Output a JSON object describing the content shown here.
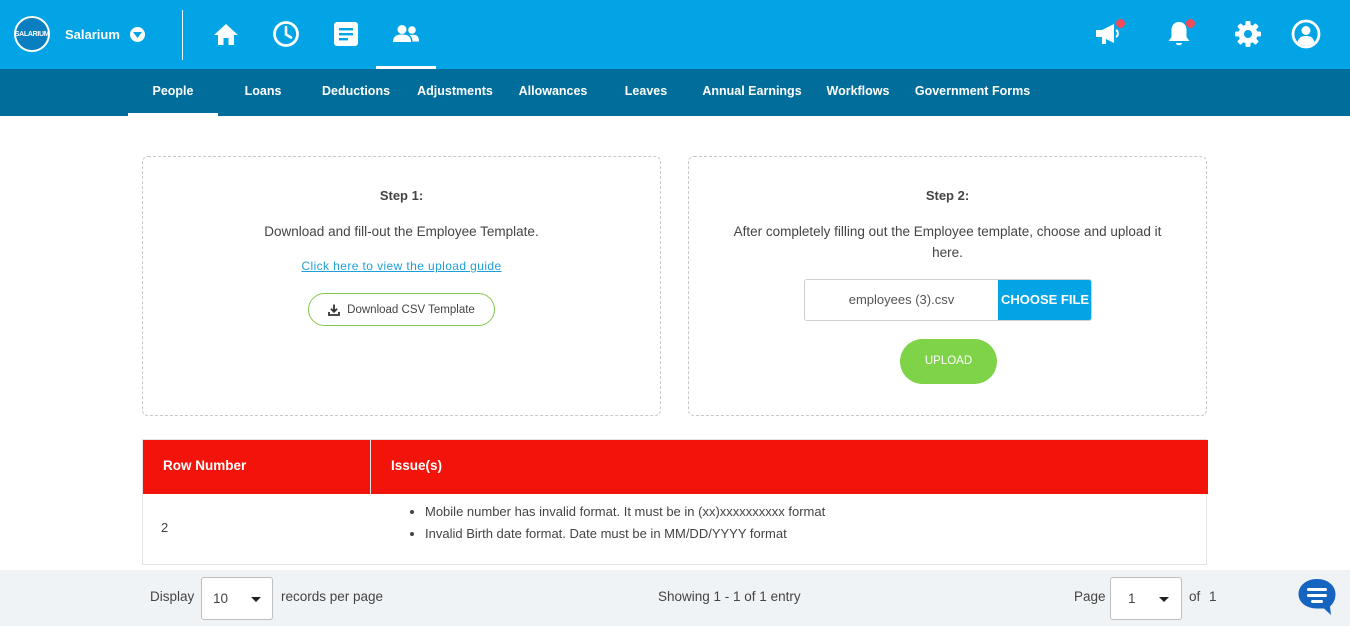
{
  "colors": {
    "topbar": "#02a4e5",
    "subnav": "#016d9b",
    "table_header": "#f2140a",
    "upload": "#7ed348",
    "choose": "#02a4e5",
    "link": "#1f9fd8"
  },
  "header": {
    "logo_text": "SALARIUM",
    "company_name": "Salarium",
    "nav_icons": [
      "home-icon",
      "clock-icon",
      "document-icon",
      "people-icon"
    ],
    "right_icons": [
      "megaphone-icon",
      "bell-icon",
      "gear-icon",
      "user-icon"
    ]
  },
  "subnav": {
    "items": [
      {
        "label": "People"
      },
      {
        "label": "Loans"
      },
      {
        "label": "Deductions"
      },
      {
        "label": "Adjustments"
      },
      {
        "label": "Allowances"
      },
      {
        "label": "Leaves"
      },
      {
        "label": "Annual Earnings"
      },
      {
        "label": "Workflows"
      },
      {
        "label": "Government Forms"
      }
    ]
  },
  "step1": {
    "title": "Step 1:",
    "text": "Download and fill-out the Employee Template.",
    "guide_link": "Click here to view the upload guide",
    "download_label": "Download CSV Template"
  },
  "step2": {
    "title": "Step 2:",
    "text": "After completely filling out the Employee template, choose and upload it here.",
    "file_name": "employees (3).csv",
    "choose_label": "CHOOSE FILE",
    "upload_label": "UPLOAD"
  },
  "issues_table": {
    "columns": [
      "Row Number",
      "Issue(s)"
    ],
    "rows": [
      {
        "row_number": "2",
        "issues": [
          "Mobile number has invalid format. It must be in (xx)xxxxxxxxxx format",
          "Invalid Birth date format. Date must be in MM/DD/YYYY format"
        ]
      }
    ]
  },
  "footer": {
    "display_label": "Display",
    "per_page_value": "10",
    "records_label": "records per page",
    "showing_text": "Showing 1 - 1 of 1 entry",
    "page_label": "Page",
    "page_value": "1",
    "of_label": "of",
    "total_pages": "1"
  }
}
